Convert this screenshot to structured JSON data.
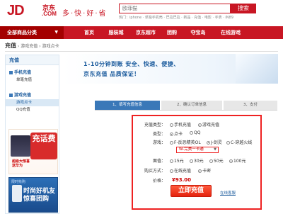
{
  "header": {
    "logo": "JD",
    "logo_cn": "京东",
    "logo_com": ".COM",
    "slogan": "多·快·好·省",
    "search_placeholder": "欧菲猫",
    "search_button": "搜索",
    "hot_words": "热门：iphone · 单独手机壳 · 巴拉巴拉 · 新品 · 充值 · 电影 · 手表 · iN89"
  },
  "nav": {
    "category_label": "全部商品分类",
    "items": [
      "首页",
      "服装城",
      "京东超市",
      "团购",
      "夺宝岛",
      "在线游戏"
    ]
  },
  "breadcrumb": {
    "root": "充值",
    "path": [
      "游戏充值",
      "游戏点卡"
    ]
  },
  "sidebar": {
    "title": "充值",
    "groups": [
      {
        "label": "手机充值",
        "subs": [
          {
            "label": "单笔充值",
            "active": false
          }
        ]
      },
      {
        "label": "游戏充值",
        "subs": [
          {
            "label": "游戏点卡",
            "active": true
          },
          {
            "label": "QQ充值",
            "active": false
          }
        ]
      }
    ],
    "ad1": {
      "big_text": "充话费",
      "line1": "超级大惊喜",
      "line2": "送华为"
    },
    "ad2": {
      "top_label": "限时抢购",
      "title_l1": "时尚好机友",
      "title_l2": "惊喜团购"
    }
  },
  "banner": {
    "line1": "1-10分钟到账 安全、快速、便捷、",
    "line2": "京东充值 品质保证！"
  },
  "steps": [
    "1、填写充值信息",
    "2、确认订单信息",
    "3、支付"
  ],
  "form": {
    "recharge_type": {
      "label": "充值类型：",
      "options": [
        "手机充值",
        "游戏充值"
      ],
      "selected": "游戏充值"
    },
    "kind": {
      "label": "类型：",
      "options": [
        "点卡",
        "QQ"
      ],
      "selected": "点卡"
    },
    "game": {
      "label": "游戏：",
      "options": [
        "F-反恐精英OL",
        "J-剑灵",
        "C-穿越火线"
      ],
      "selected": "J-剑灵"
    },
    "server_select": "W-完美一卡通",
    "face_value": {
      "label": "面值：",
      "options": [
        "15元",
        "30元",
        "50元",
        "100元"
      ],
      "selected": "100元"
    },
    "buy_method": {
      "label": "购买方式：",
      "options": [
        "在线充值",
        "卡密"
      ],
      "selected": "卡密"
    },
    "price": {
      "label": "价格：",
      "value": "¥93.00"
    },
    "submit": "立即充值",
    "help": "在线客服"
  }
}
